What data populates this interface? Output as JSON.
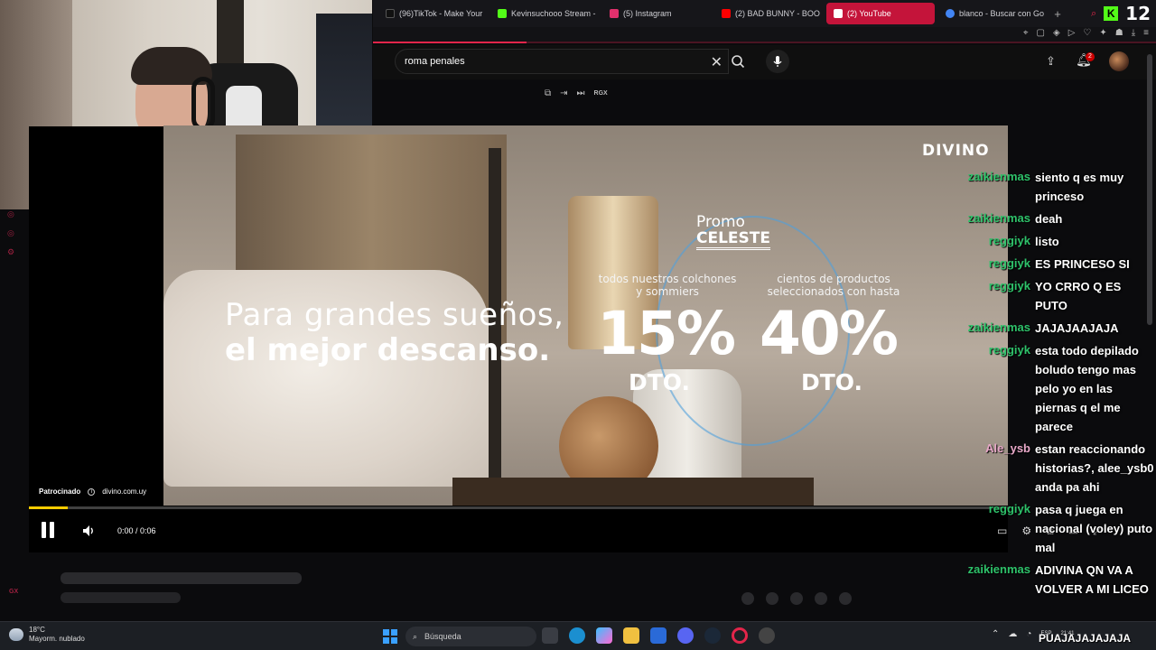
{
  "browser": {
    "tabs": [
      {
        "label": "(96)TikTok - Make Your",
        "color": "#111111"
      },
      {
        "label": "Kevinsuchooo Stream -",
        "color": "#53fc18"
      },
      {
        "label": "(5) Instagram",
        "color": "#e1306c"
      },
      {
        "label": "(2) BAD BUNNY - BOO",
        "color": "#ff0000"
      },
      {
        "label": "(2) YouTube",
        "color": "#ff0000",
        "active": true
      },
      {
        "label": "blanco - Buscar con Go",
        "color": "#4285f4"
      }
    ],
    "new_tab": "+",
    "kick_logo": "K",
    "kick_count": "12"
  },
  "youtube": {
    "search_value": "roma penales",
    "notification_count": "2",
    "ext_label": "RGX"
  },
  "ad": {
    "brand": "DIVINO",
    "headline_line1": "Para grandes sueños,",
    "headline_line2": "el mejor descanso.",
    "promo_line1": "Promo",
    "promo_line2": "CELESTE",
    "left_sub": "todos nuestros colchones y sommiers",
    "right_sub": "cientos de productos seleccionados con hasta",
    "left_pct": "15%",
    "right_pct": "40%",
    "dto": "DTO.",
    "sponsored": "Patrocinado",
    "sponsor_url": "divino.com.uy"
  },
  "player": {
    "time": "0:00 / 0:06",
    "progress": 0.04,
    "accent": "#ffcc00"
  },
  "chat": [
    {
      "user": "zaikienmas",
      "color": "#2ec26a",
      "text": "siento q es muy princeso"
    },
    {
      "user": "zaikienmas",
      "color": "#2ec26a",
      "text": "deah"
    },
    {
      "user": "reggiyk",
      "color": "#2ec26a",
      "text": "listo"
    },
    {
      "user": "reggiyk",
      "color": "#2ec26a",
      "text": "ES PRINCESO SI"
    },
    {
      "user": "reggiyk",
      "color": "#2ec26a",
      "text": "YO CRRO Q ES PUTO"
    },
    {
      "user": "zaikienmas",
      "color": "#2ec26a",
      "text": "JAJAJAAJAJA"
    },
    {
      "user": "reggiyk",
      "color": "#2ec26a",
      "text": "esta todo depilado boludo tengo mas pelo yo en las piernas q el me parece"
    },
    {
      "user": "Ale_ysb",
      "color": "#e8a8c8",
      "text": "estan reaccionando historias?, alee_ysb0 anda pa ahi"
    },
    {
      "user": "reggiyk",
      "color": "#2ec26a",
      "text": "pasa q juega en nacional (voley) puto mal"
    },
    {
      "user": "zaikienmas",
      "color": "#2ec26a",
      "text": "ADIVINA QN VA A VOLVER A MI LICEO"
    }
  ],
  "overlay_bottom": "PUAJAJAJAJAJA",
  "taskbar": {
    "weather_temp": "18°C",
    "weather_desc": "Mayorm. nublado",
    "search_placeholder": "Búsqueda",
    "lang": "ESP",
    "clock": "21:41"
  }
}
